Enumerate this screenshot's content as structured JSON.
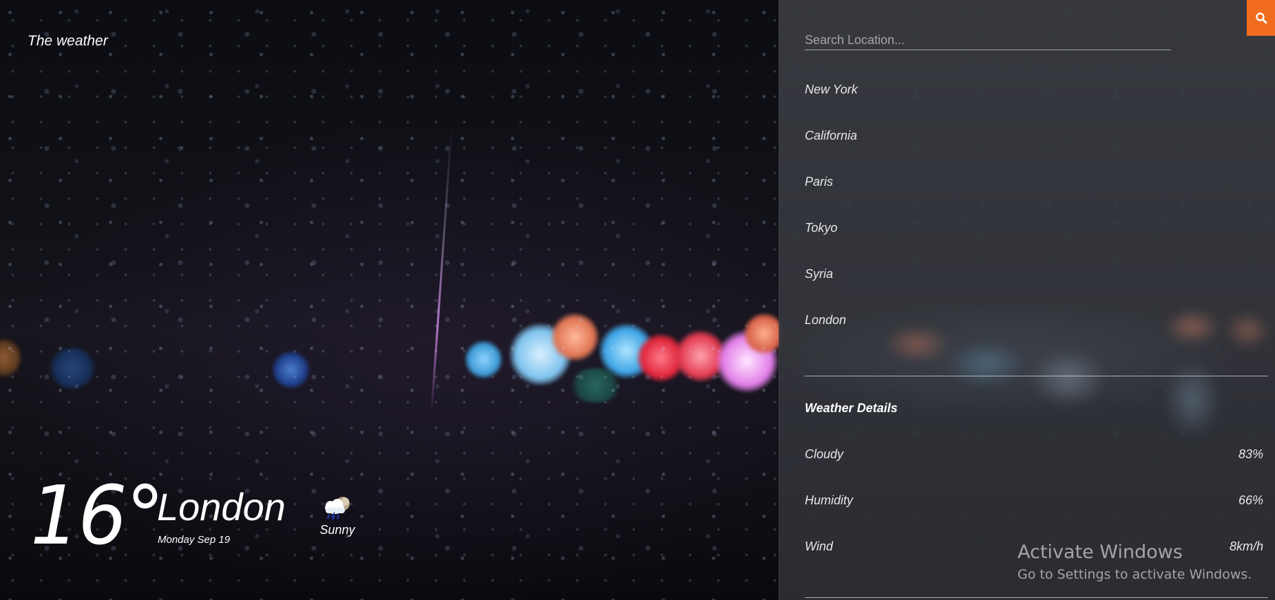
{
  "brand": {
    "title": "The weather"
  },
  "current": {
    "temperature": "16°",
    "city": "London",
    "date": "Monday Sep 19",
    "condition": "Sunny",
    "condition_icon": "cloud-rain-icon"
  },
  "search": {
    "placeholder": "Search Location...",
    "value": "",
    "button_icon": "search-icon"
  },
  "locations": [
    "New York",
    "California",
    "Paris",
    "Tokyo",
    "Syria",
    "London"
  ],
  "details": {
    "title": "Weather Details",
    "rows": [
      {
        "label": "Cloudy",
        "value": "83%"
      },
      {
        "label": "Humidity",
        "value": "66%"
      },
      {
        "label": "Wind",
        "value": "8km/h"
      }
    ]
  },
  "watermark": {
    "title": "Activate Windows",
    "subtitle": "Go to Settings to activate Windows."
  },
  "colors": {
    "accent": "#f26c1f",
    "panel": "#3a3c42",
    "text": "#ffffff"
  }
}
